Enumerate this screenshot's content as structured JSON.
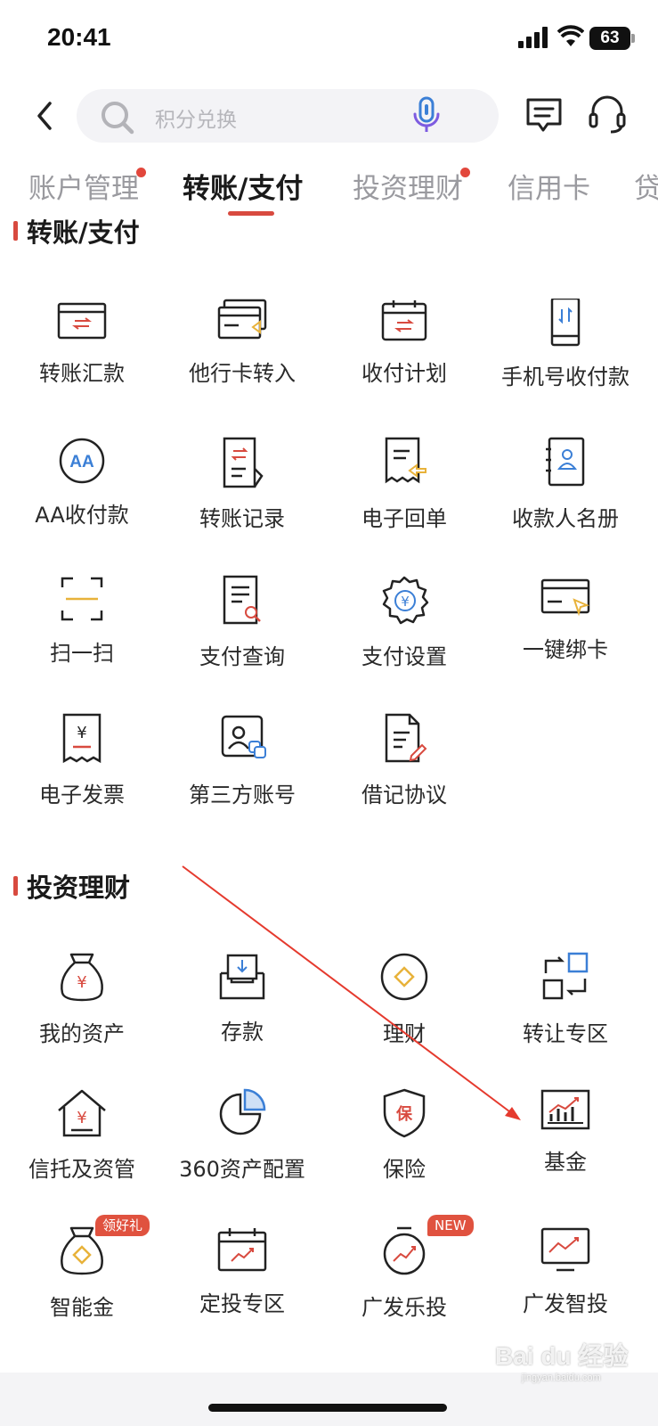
{
  "status": {
    "time": "20:41",
    "battery": "63"
  },
  "search": {
    "placeholder": "积分兑换"
  },
  "tabs": [
    {
      "label": "账户管理",
      "dot": true
    },
    {
      "label": "转账/支付",
      "active": true
    },
    {
      "label": "投资理财",
      "dot": true
    },
    {
      "label": "信用卡"
    },
    {
      "label": "贷"
    }
  ],
  "sections": {
    "transfer": {
      "title": "转账/支付",
      "items": [
        "转账汇款",
        "他行卡转入",
        "收付计划",
        "手机号收付款",
        "AA收付款",
        "转账记录",
        "电子回单",
        "收款人名册",
        "扫一扫",
        "支付查询",
        "支付设置",
        "一键绑卡",
        "电子发票",
        "第三方账号",
        "借记协议"
      ]
    },
    "invest": {
      "title": "投资理财",
      "items": [
        "我的资产",
        "存款",
        "理财",
        "转让专区",
        "信托及资管",
        "360资产配置",
        "保险",
        "基金",
        "智能金",
        "定投专区",
        "广发乐投",
        "广发智投"
      ],
      "badges": {
        "gift": "领好礼",
        "new": "NEW"
      }
    }
  },
  "icons": {
    "aa": "AA",
    "yuan": "¥",
    "bao": "保"
  },
  "watermark": {
    "text": "Bai du 经验",
    "sub": "jingyan.baidu.com"
  },
  "colors": {
    "accent": "#d84a3f",
    "gold": "#e8b23a",
    "blue": "#3b7fd6"
  }
}
